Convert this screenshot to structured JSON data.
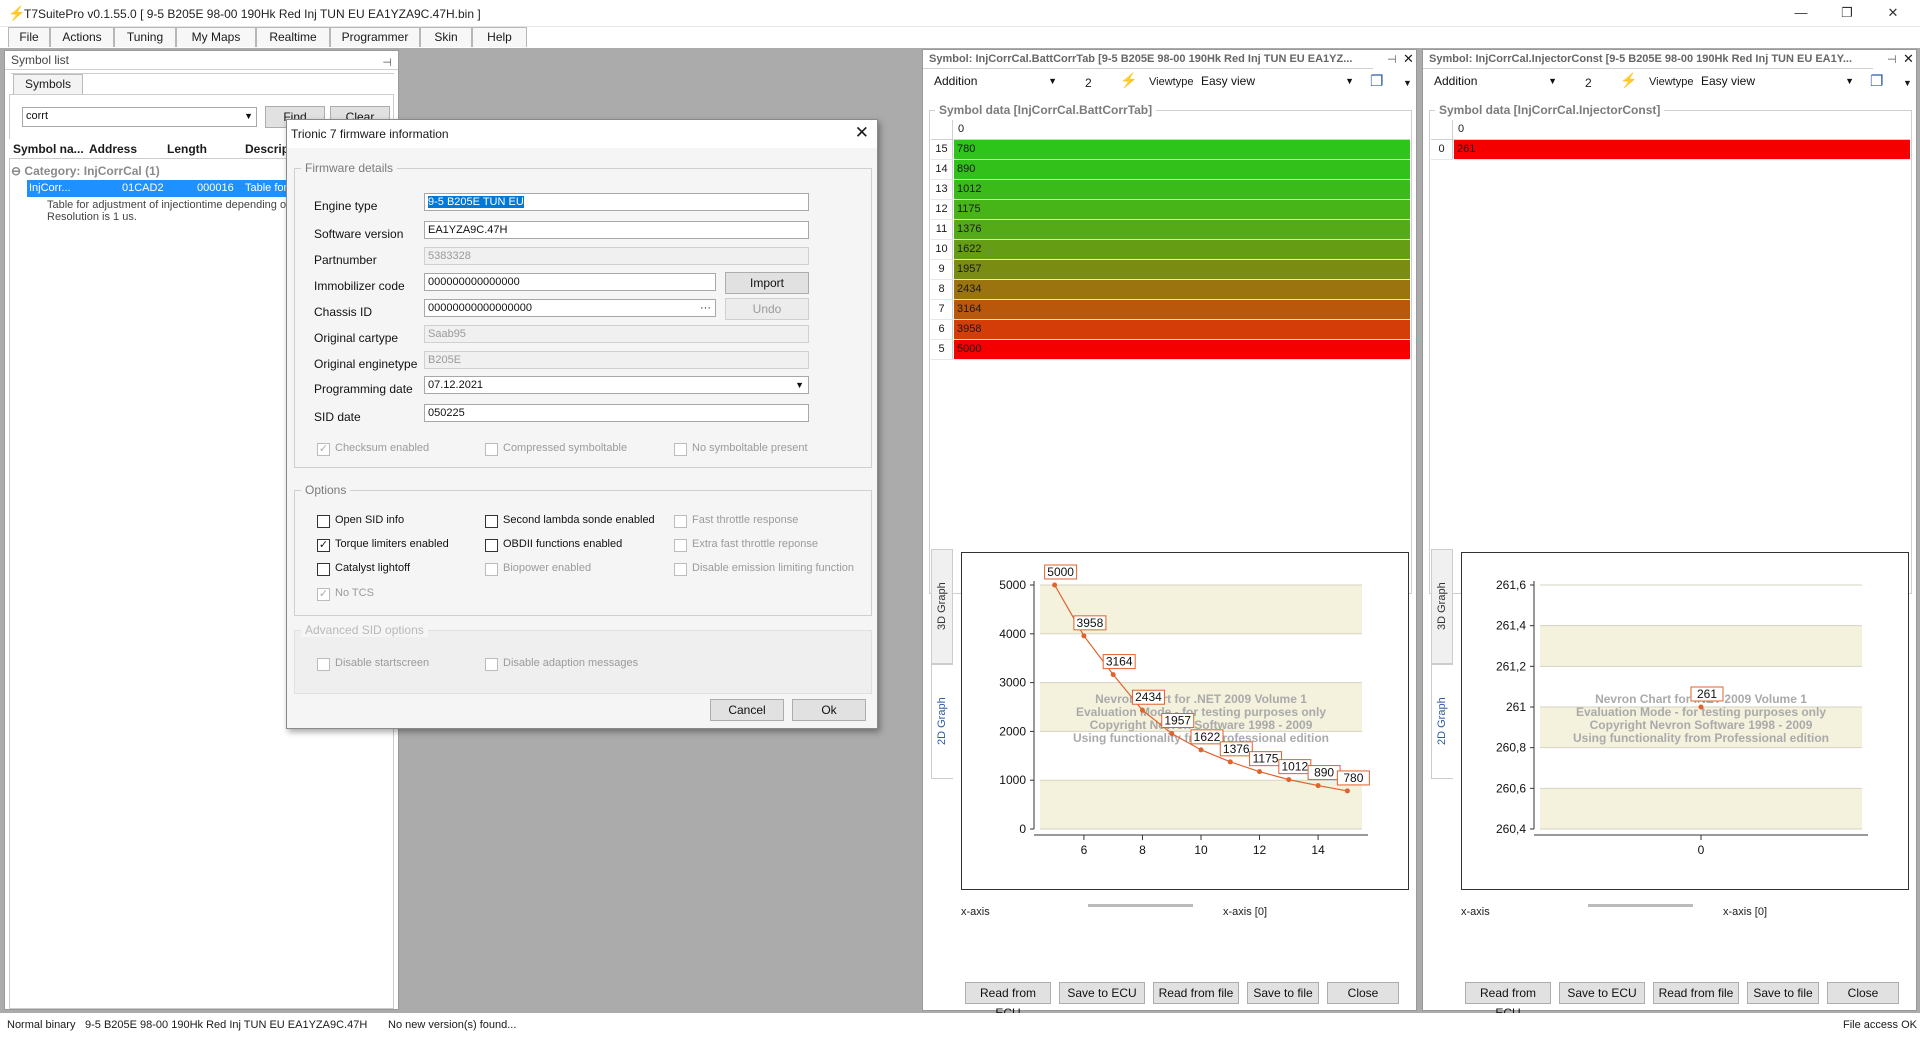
{
  "app": {
    "title": "T7SuitePro v0.1.55.0 [ 9-5 B205E 98-00 190Hk Red Inj TUN EU EA1YZA9C.47H.bin ]"
  },
  "menu": [
    "File",
    "Actions",
    "Tuning",
    "My Maps",
    "Realtime",
    "Programmer",
    "Skin",
    "Help"
  ],
  "symbol_list": {
    "title": "Symbol list",
    "tab": "Symbols",
    "search_value": "corrt",
    "find_label": "Find",
    "clear_label": "Clear",
    "columns": [
      "Symbol na...",
      "Address",
      "Length",
      "Descript"
    ],
    "category": "Category: InjCorrCal (1)",
    "row": {
      "name": "InjCorr...",
      "address": "01CAD2",
      "length": "000016",
      "desc": "Table for"
    },
    "detail_line1": "Table for adjustment of injectiontime depending o",
    "detail_line2": "Resolution is 1 us."
  },
  "dialog": {
    "title": "Trionic 7 firmware information",
    "firmware_group": "Firmware details",
    "fields": {
      "engine_type": {
        "label": "Engine type",
        "value": "9-5 B205E TUN EU"
      },
      "software_version": {
        "label": "Software version",
        "value": "EA1YZA9C.47H"
      },
      "partnumber": {
        "label": "Partnumber",
        "value": "5383328"
      },
      "immobilizer": {
        "label": "Immobilizer code",
        "value": "000000000000000"
      },
      "chassis": {
        "label": "Chassis ID",
        "value": "00000000000000000"
      },
      "cartype": {
        "label": "Original cartype",
        "value": "Saab95"
      },
      "enginetype": {
        "label": "Original enginetype",
        "value": "B205E"
      },
      "prog_date": {
        "label": "Programming date",
        "value": "07.12.2021"
      },
      "sid_date": {
        "label": "SID date",
        "value": "050225"
      }
    },
    "import_label": "Import",
    "undo_label": "Undo",
    "ellipsis": "···",
    "checks": {
      "checksum": "Checksum enabled",
      "compressed": "Compressed symboltable",
      "nosym": "No symboltable present"
    },
    "options_group": "Options",
    "options": {
      "open_sid": "Open SID info",
      "torque": "Torque limiters enabled",
      "catalyst": "Catalyst lightoff",
      "no_tcs": "No TCS",
      "second_lambda": "Second lambda sonde enabled",
      "obdii": "OBDII functions enabled",
      "biopower": "Biopower enabled",
      "fast_throttle": "Fast throttle response",
      "extra_fast": "Extra fast throttle reponse",
      "disable_emission": "Disable emission limiting function"
    },
    "adv_group": "Advanced SID options",
    "adv": {
      "startscreen": "Disable startscreen",
      "adaption": "Disable adaption messages"
    },
    "cancel_label": "Cancel",
    "ok_label": "Ok"
  },
  "viewer1": {
    "title": "Symbol: InjCorrCal.BattCorrTab [9-5 B205E 98-00 190Hk Red Inj TUN EU EA1YZ...",
    "mode": "Addition",
    "amount": "2",
    "viewtype_label": "Viewtype",
    "viewtype": "Easy view",
    "data_title": "Symbol data [InjCorrCal.BattCorrTab]",
    "header_col": "0",
    "rows": [
      {
        "idx": "15",
        "val": "780",
        "color": "#2dc51a"
      },
      {
        "idx": "14",
        "val": "890",
        "color": "#31c11a"
      },
      {
        "idx": "13",
        "val": "1012",
        "color": "#3bbb19"
      },
      {
        "idx": "12",
        "val": "1175",
        "color": "#47b418"
      },
      {
        "idx": "11",
        "val": "1376",
        "color": "#54ab17"
      },
      {
        "idx": "10",
        "val": "1622",
        "color": "#659d15"
      },
      {
        "idx": "9",
        "val": "1957",
        "color": "#7b8c12"
      },
      {
        "idx": "8",
        "val": "2434",
        "color": "#9b740f"
      },
      {
        "idx": "7",
        "val": "3164",
        "color": "#b9580b"
      },
      {
        "idx": "6",
        "val": "3958",
        "color": "#d43d07"
      },
      {
        "idx": "5",
        "val": "5000",
        "color": "#f40000"
      }
    ],
    "tabs": [
      "3D Graph",
      "2D Graph"
    ],
    "xaxis_label": "x-axis",
    "xaxis_value": "x-axis [0]",
    "watermark": [
      "Nevron Chart for .NET 2009 Volume 1",
      "Evaluation Mode - for testing purposes only",
      "Copyright Nevron Software 1998 - 2009",
      "Using functionality from Professional edition"
    ],
    "buttons": [
      "Read from ECU",
      "Save to ECU",
      "Read from file",
      "Save to file",
      "Close"
    ]
  },
  "viewer2": {
    "title": "Symbol: InjCorrCal.InjectorConst [9-5 B205E 98-00 190Hk Red Inj TUN EU EA1Y...",
    "mode": "Addition",
    "amount": "2",
    "viewtype_label": "Viewtype",
    "viewtype": "Easy view",
    "data_title": "Symbol data [InjCorrCal.InjectorConst]",
    "header_col": "0",
    "rows": [
      {
        "idx": "0",
        "val": "261",
        "color": "#f40000"
      }
    ],
    "tabs": [
      "3D Graph",
      "2D Graph"
    ],
    "xaxis_label": "x-axis",
    "xaxis_value": "x-axis [0]",
    "watermark": [
      "Nevron Chart for .NET 2009 Volume 1",
      "Evaluation Mode - for testing purposes only",
      "Copyright Nevron Software 1998 - 2009",
      "Using functionality from Professional edition"
    ],
    "buttons": [
      "Read from ECU",
      "Save to ECU",
      "Read from file",
      "Save to file",
      "Close"
    ]
  },
  "chart_data": [
    {
      "type": "line",
      "x": [
        5,
        6,
        7,
        8,
        9,
        10,
        11,
        12,
        13,
        14,
        15
      ],
      "values": [
        5000,
        3958,
        3164,
        2434,
        1957,
        1622,
        1376,
        1175,
        1012,
        890,
        780
      ],
      "xticks": [
        6,
        8,
        10,
        12,
        14
      ],
      "yticks": [
        0,
        1000,
        2000,
        3000,
        4000,
        5000
      ],
      "ylim": [
        0,
        5000
      ],
      "xlim": [
        4.5,
        15.5
      ],
      "color": "#e0622c",
      "grid": true
    },
    {
      "type": "scatter",
      "x": [
        0
      ],
      "values": [
        261
      ],
      "xticks": [
        0
      ],
      "yticks": [
        "260,4",
        "260,6",
        "260,8",
        "261",
        "261,2",
        "261,4",
        "261,6"
      ],
      "ylim": [
        260.4,
        261.6
      ],
      "color": "#e0622c",
      "grid": true
    }
  ],
  "status": {
    "left": "Normal binary",
    "file": "9-5 B205E 98-00 190Hk Red Inj TUN EU EA1YZA9C.47H",
    "msg": "No new version(s) found...",
    "right": "File access OK"
  }
}
